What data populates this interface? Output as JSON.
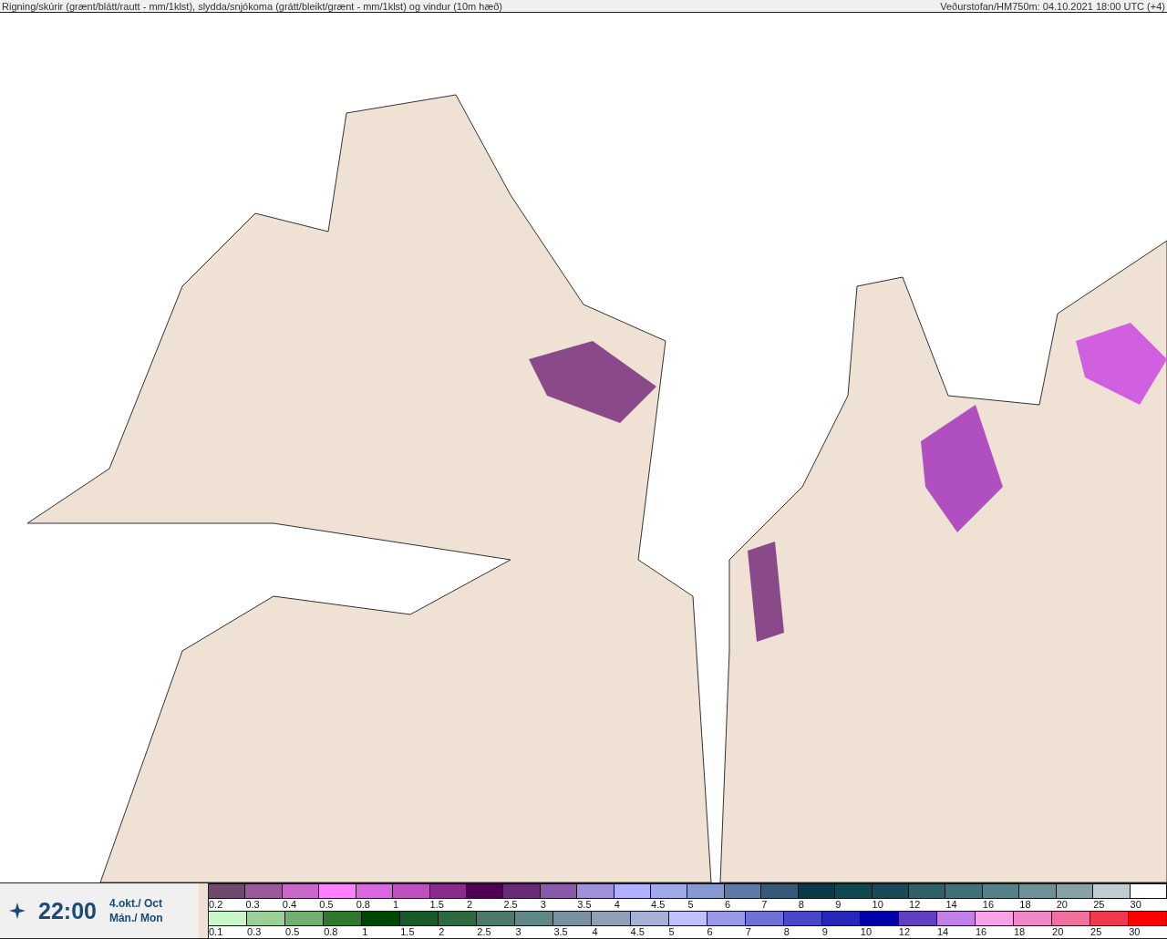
{
  "header": {
    "title": "Rigning/skúrir (grænt/blátt/rautt - mm/1klst), slydda/snjókoma (grátt/bleikt/grænt - mm/1klst) og vindur (10m hæð)",
    "source": "Veðurstofan/HM750m: 04.10.2021 18:00 UTC (+4)"
  },
  "time_panel": {
    "time": "22:00",
    "date": "4.okt./ Oct",
    "day": "Mán./ Mon"
  },
  "legend": {
    "upper_scale": [
      {
        "label": "0.2",
        "color": "#6e4a6e"
      },
      {
        "label": "0.3",
        "color": "#9a5a9a"
      },
      {
        "label": "0.4",
        "color": "#c868c8"
      },
      {
        "label": "0.5",
        "color": "#ff80ff"
      },
      {
        "label": "0.8",
        "color": "#d868e0"
      },
      {
        "label": "1",
        "color": "#c050c0"
      },
      {
        "label": "1.5",
        "color": "#8a2a8a"
      },
      {
        "label": "2",
        "color": "#500050"
      },
      {
        "label": "2.5",
        "color": "#6a2a7a"
      },
      {
        "label": "3",
        "color": "#8a5aaa"
      },
      {
        "label": "3.5",
        "color": "#a090d8"
      },
      {
        "label": "4",
        "color": "#b0b0ff"
      },
      {
        "label": "4.5",
        "color": "#a0a8e8"
      },
      {
        "label": "5",
        "color": "#8898d0"
      },
      {
        "label": "6",
        "color": "#6078a8"
      },
      {
        "label": "7",
        "color": "#385878"
      },
      {
        "label": "8",
        "color": "#0a3a48"
      },
      {
        "label": "9",
        "color": "#104850"
      },
      {
        "label": "10",
        "color": "#1a4a58"
      },
      {
        "label": "12",
        "color": "#306068"
      },
      {
        "label": "14",
        "color": "#407078"
      },
      {
        "label": "16",
        "color": "#588088"
      },
      {
        "label": "18",
        "color": "#709098"
      },
      {
        "label": "20",
        "color": "#88a0a8"
      },
      {
        "label": "25",
        "color": "#c0ccd0"
      },
      {
        "label": "30",
        "color": "#ffffff"
      }
    ],
    "lower_scale": [
      {
        "label": "0.1",
        "color": "#c8f8c8"
      },
      {
        "label": "0.3",
        "color": "#98d098"
      },
      {
        "label": "0.5",
        "color": "#70b070"
      },
      {
        "label": "0.8",
        "color": "#307830"
      },
      {
        "label": "1",
        "color": "#004800"
      },
      {
        "label": "1.5",
        "color": "#1a5a2a"
      },
      {
        "label": "2",
        "color": "#2e6a40"
      },
      {
        "label": "2.5",
        "color": "#4a7a68"
      },
      {
        "label": "3",
        "color": "#608888"
      },
      {
        "label": "3.5",
        "color": "#7890a0"
      },
      {
        "label": "4",
        "color": "#90a0b8"
      },
      {
        "label": "4.5",
        "color": "#a8b0d8"
      },
      {
        "label": "5",
        "color": "#c0c0ff"
      },
      {
        "label": "6",
        "color": "#9898e8"
      },
      {
        "label": "7",
        "color": "#7070d8"
      },
      {
        "label": "8",
        "color": "#4848c8"
      },
      {
        "label": "9",
        "color": "#2828b8"
      },
      {
        "label": "10",
        "color": "#0000a8"
      },
      {
        "label": "12",
        "color": "#6040c0"
      },
      {
        "label": "14",
        "color": "#c080e8"
      },
      {
        "label": "16",
        "color": "#f8a0e8"
      },
      {
        "label": "18",
        "color": "#f088c8"
      },
      {
        "label": "20",
        "color": "#f070a0"
      },
      {
        "label": "25",
        "color": "#f03850"
      },
      {
        "label": "30",
        "color": "#ff0000"
      }
    ]
  }
}
